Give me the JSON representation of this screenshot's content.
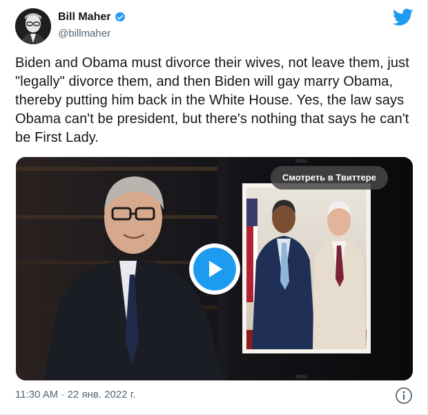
{
  "tweet": {
    "author": {
      "name": "Bill Maher",
      "handle": "@billmaher",
      "verified": true
    },
    "text": "Biden and Obama must divorce their wives, not leave them, just \"legally\" divorce them, and then Biden will gay marry Obama, thereby putting him back in the White House. Yes, the law says Obama can't be president, but there's nothing that says he can't be First Lady.",
    "media": {
      "type": "video",
      "watch_label": "Смотреть в Твиттере",
      "play_icon": "play-icon"
    },
    "timestamp": "11:30 AM · 22 янв. 2022 г.",
    "icons": {
      "brand": "twitter-bird-icon",
      "verified": "verified-badge-icon",
      "info": "info-icon"
    }
  },
  "colors": {
    "accent": "#1d9bf0",
    "text": "#0f1419",
    "secondary": "#536471"
  }
}
